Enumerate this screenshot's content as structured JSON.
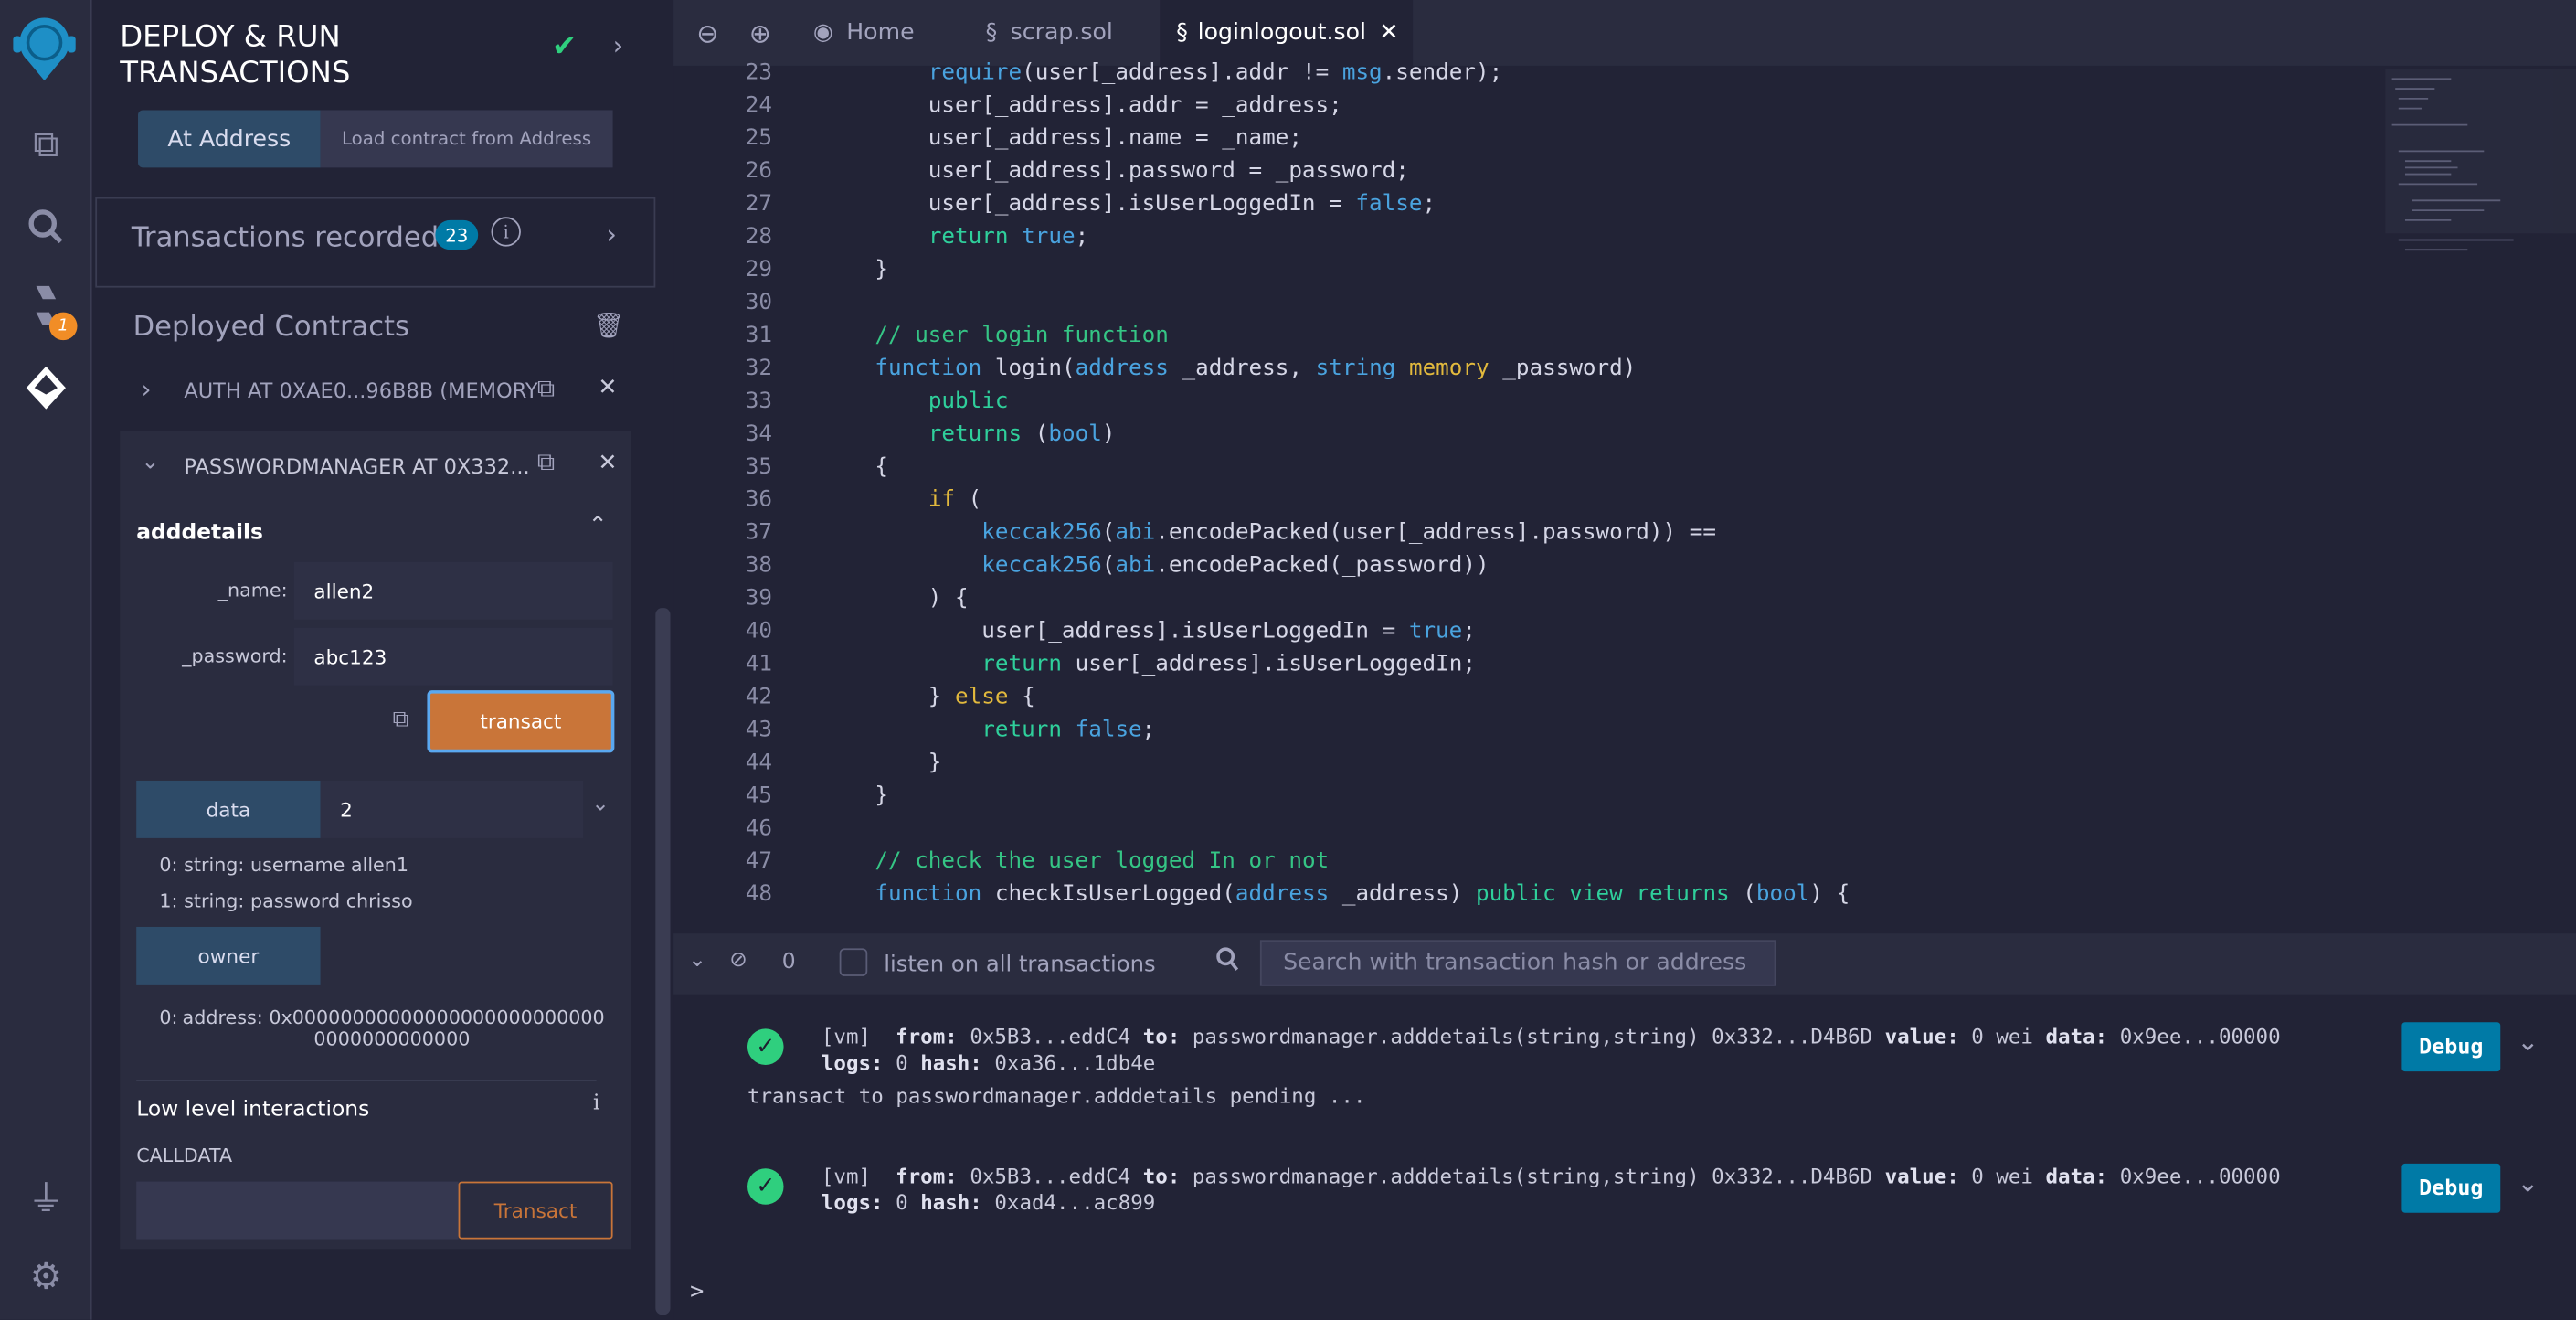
{
  "iconbar": {
    "items": [
      "remix-logo-icon",
      "file-explorer-icon",
      "search-icon",
      "solidity-compiler-icon",
      "deploy-run-icon",
      "plugin-manager-icon",
      "settings-icon"
    ],
    "compiler_badge": "1"
  },
  "side": {
    "title_line1": "DEPLOY & RUN",
    "title_line2": "TRANSACTIONS",
    "at_address": "At Address",
    "load_placeholder": "Load contract from Address",
    "tx_recorded": "Transactions recorded",
    "tx_count": "23",
    "deployed_title": "Deployed Contracts",
    "contracts": [
      {
        "name": "AUTH AT 0XAE0...96B8B (MEMORY"
      },
      {
        "name": "PASSWORDMANAGER AT 0X332..."
      }
    ],
    "fn": {
      "name": "adddetails",
      "params": [
        {
          "label": "_name:",
          "value": "allen2"
        },
        {
          "label": "_password:",
          "value": "abc123"
        }
      ],
      "transact": "transact"
    },
    "data_btn": "data",
    "data_value": "2",
    "data_results": [
      "0: string: username allen1",
      "1: string: password chrisso"
    ],
    "owner_btn": "owner",
    "owner_result_label": "0:",
    "owner_result_line1": "address: 0x00000000000000000000000000",
    "owner_result_line2": "0000000000000",
    "low_level": "Low level interactions",
    "calldata": "CALLDATA",
    "transact_btn": "Transact"
  },
  "editor": {
    "tabs": [
      {
        "label": "Home"
      },
      {
        "label": "scrap.sol"
      },
      {
        "label": "loginlogout.sol",
        "active": true
      }
    ],
    "lines": [
      {
        "n": "23",
        "t": [
          [
            "        ",
            ""
          ],
          [
            "require",
            "k-blue"
          ],
          [
            "(user[_address].addr != ",
            ""
          ],
          [
            "msg",
            "k-blue"
          ],
          [
            ".sender);",
            ""
          ]
        ]
      },
      {
        "n": "24",
        "t": [
          [
            "        user[_address].addr = _address;",
            ""
          ]
        ]
      },
      {
        "n": "25",
        "t": [
          [
            "        user[_address].name = _name;",
            ""
          ]
        ]
      },
      {
        "n": "26",
        "t": [
          [
            "        user[_address].password = _password;",
            ""
          ]
        ]
      },
      {
        "n": "27",
        "t": [
          [
            "        user[_address].isUserLoggedIn = ",
            ""
          ],
          [
            "false",
            "k-blue"
          ],
          [
            ";",
            ""
          ]
        ]
      },
      {
        "n": "28",
        "t": [
          [
            "        ",
            ""
          ],
          [
            "return",
            "k-green"
          ],
          [
            " ",
            ""
          ],
          [
            "true",
            "k-blue"
          ],
          [
            ";",
            ""
          ]
        ]
      },
      {
        "n": "29",
        "t": [
          [
            "    }",
            ""
          ]
        ]
      },
      {
        "n": "30",
        "t": [
          [
            "",
            ""
          ]
        ]
      },
      {
        "n": "31",
        "t": [
          [
            "    ",
            ""
          ],
          [
            "// user login function",
            "k-com"
          ]
        ]
      },
      {
        "n": "32",
        "t": [
          [
            "    ",
            ""
          ],
          [
            "function",
            "k-blue"
          ],
          [
            " login(",
            ""
          ],
          [
            "address",
            "k-blue"
          ],
          [
            " _address, ",
            ""
          ],
          [
            "string",
            "k-blue"
          ],
          [
            " ",
            ""
          ],
          [
            "memory",
            "k-yellow"
          ],
          [
            " _password)",
            ""
          ]
        ]
      },
      {
        "n": "33",
        "t": [
          [
            "        ",
            ""
          ],
          [
            "public",
            "k-green"
          ]
        ]
      },
      {
        "n": "34",
        "t": [
          [
            "        ",
            ""
          ],
          [
            "returns",
            "k-green"
          ],
          [
            " (",
            ""
          ],
          [
            "bool",
            "k-blue"
          ],
          [
            ")",
            ""
          ]
        ]
      },
      {
        "n": "35",
        "t": [
          [
            "    {",
            ""
          ]
        ]
      },
      {
        "n": "36",
        "t": [
          [
            "        ",
            ""
          ],
          [
            "if",
            "k-yellow"
          ],
          [
            " (",
            ""
          ]
        ]
      },
      {
        "n": "37",
        "t": [
          [
            "            ",
            ""
          ],
          [
            "keccak256",
            "k-blue"
          ],
          [
            "(",
            ""
          ],
          [
            "abi",
            "k-blue"
          ],
          [
            ".encodePacked(user[_address].password)) ==",
            ""
          ]
        ]
      },
      {
        "n": "38",
        "t": [
          [
            "            ",
            ""
          ],
          [
            "keccak256",
            "k-blue"
          ],
          [
            "(",
            ""
          ],
          [
            "abi",
            "k-blue"
          ],
          [
            ".encodePacked(_password))",
            ""
          ]
        ]
      },
      {
        "n": "39",
        "t": [
          [
            "        ) {",
            ""
          ]
        ]
      },
      {
        "n": "40",
        "t": [
          [
            "            user[_address].isUserLoggedIn = ",
            ""
          ],
          [
            "true",
            "k-blue"
          ],
          [
            ";",
            ""
          ]
        ]
      },
      {
        "n": "41",
        "t": [
          [
            "            ",
            ""
          ],
          [
            "return",
            "k-green"
          ],
          [
            " user[_address].isUserLoggedIn;",
            ""
          ]
        ]
      },
      {
        "n": "42",
        "t": [
          [
            "        } ",
            ""
          ],
          [
            "else",
            "k-yellow"
          ],
          [
            " {",
            ""
          ]
        ]
      },
      {
        "n": "43",
        "t": [
          [
            "            ",
            ""
          ],
          [
            "return",
            "k-green"
          ],
          [
            " ",
            ""
          ],
          [
            "false",
            "k-blue"
          ],
          [
            ";",
            ""
          ]
        ]
      },
      {
        "n": "44",
        "t": [
          [
            "        }",
            ""
          ]
        ]
      },
      {
        "n": "45",
        "t": [
          [
            "    }",
            ""
          ]
        ]
      },
      {
        "n": "46",
        "t": [
          [
            "",
            ""
          ]
        ]
      },
      {
        "n": "47",
        "t": [
          [
            "    ",
            ""
          ],
          [
            "// check the user logged In or not",
            "k-com"
          ]
        ]
      },
      {
        "n": "48",
        "t": [
          [
            "    ",
            ""
          ],
          [
            "function",
            "k-blue"
          ],
          [
            " checkIsUserLogged(",
            ""
          ],
          [
            "address",
            "k-blue"
          ],
          [
            " _address) ",
            ""
          ],
          [
            "public",
            "k-green"
          ],
          [
            " ",
            ""
          ],
          [
            "view",
            "k-green"
          ],
          [
            " ",
            ""
          ],
          [
            "returns",
            "k-green"
          ],
          [
            " (",
            ""
          ],
          [
            "bool",
            "k-blue"
          ],
          [
            ") {",
            ""
          ]
        ]
      }
    ]
  },
  "terminal": {
    "count": "0",
    "listen_label": "listen on all transactions",
    "search_placeholder": "Search with transaction hash or address",
    "entries": [
      {
        "vm": "[vm]",
        "from_k": "from:",
        "from": "0x5B3...eddC4",
        "to_k": "to:",
        "to": "passwordmanager.adddetails(string,string) 0x332...D4B6D",
        "value_k": "value:",
        "value": "0 wei",
        "data_k": "data:",
        "data": "0x9ee...00000",
        "logs_k": "logs:",
        "logs": "0",
        "hash_k": "hash:",
        "hash": "0xa36...1db4e",
        "debug": "Debug"
      },
      {
        "vm": "[vm]",
        "from_k": "from:",
        "from": "0x5B3...eddC4",
        "to_k": "to:",
        "to": "passwordmanager.adddetails(string,string) 0x332...D4B6D",
        "value_k": "value:",
        "value": "0 wei",
        "data_k": "data:",
        "data": "0x9ee...00000",
        "logs_k": "logs:",
        "logs": "0",
        "hash_k": "hash:",
        "hash": "0xad4...ac899",
        "debug": "Debug"
      }
    ],
    "pending": "transact to passwordmanager.adddetails pending ...",
    "prompt": ">"
  },
  "colors": {
    "accent": "#007aa6",
    "transact": "#c97539",
    "success": "#2fcf7e",
    "badge_orange": "#f18d26"
  }
}
